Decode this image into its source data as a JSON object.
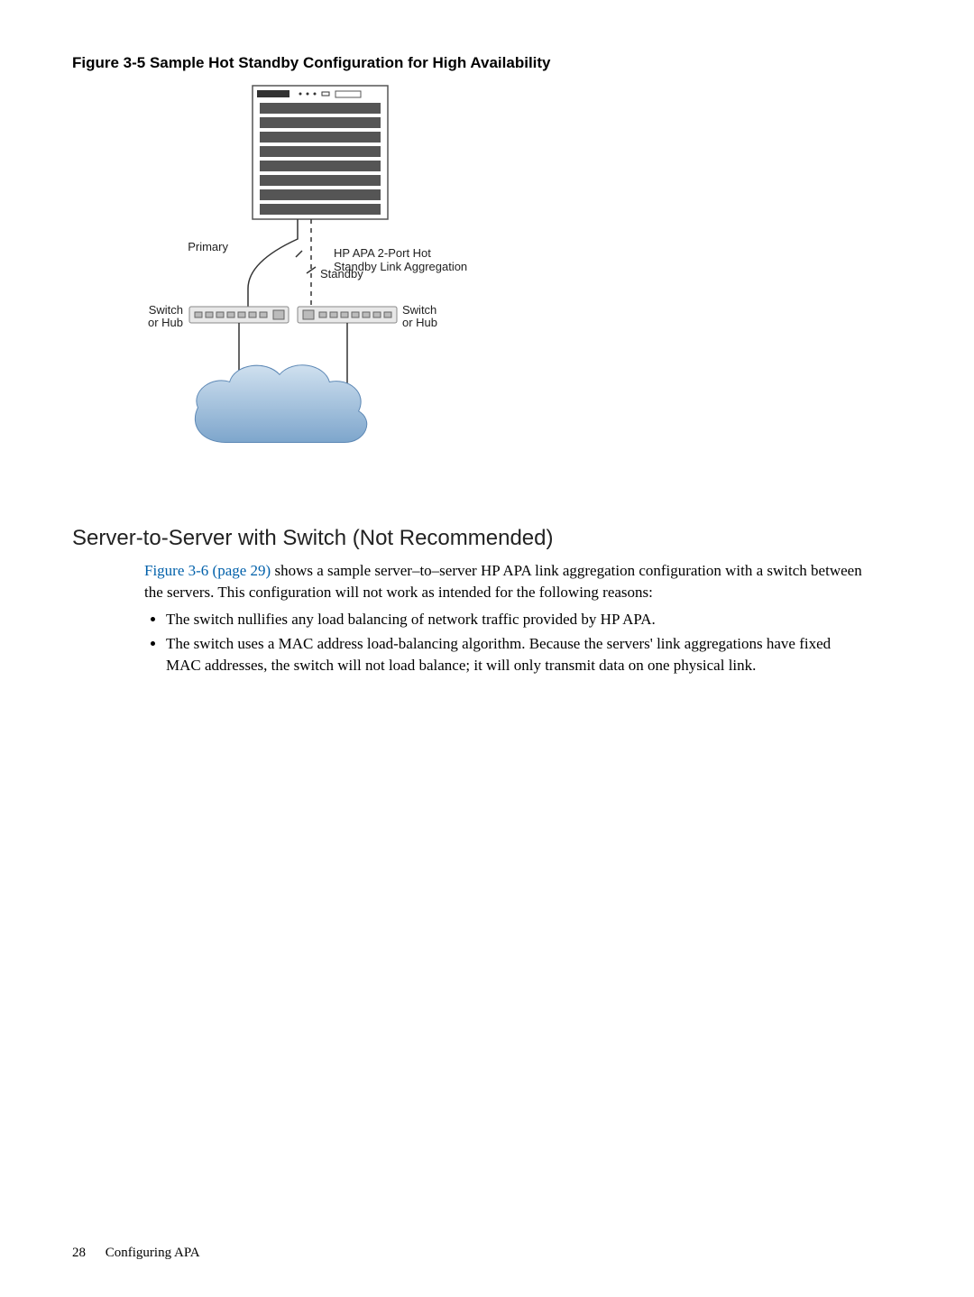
{
  "figure": {
    "caption": "Figure 3-5 Sample Hot Standby Configuration for High Availability",
    "labels": {
      "primary": "Primary",
      "standby": "Standby",
      "apa_line1": "HP APA 2-Port Hot",
      "apa_line2": "Standby Link Aggregation",
      "switch_hub_left_1": "Switch",
      "switch_hub_left_2": "or Hub",
      "switch_hub_right_1": "Switch",
      "switch_hub_right_2": "or Hub"
    }
  },
  "section": {
    "heading": "Server-to-Server with Switch (Not Recommended)",
    "para_link": "Figure 3-6 (page 29)",
    "para_rest": " shows a sample server–to–server HP APA link aggregation configuration with a switch between the servers. This configuration will not work as intended for the following reasons:",
    "bullets": [
      "The switch nullifies any load balancing of network traffic provided by HP APA.",
      "The switch uses a MAC address load-balancing algorithm. Because the servers' link aggregations have fixed MAC addresses, the switch will not load balance; it will only transmit data on one physical link."
    ]
  },
  "footer": {
    "page": "28",
    "title": "Configuring APA"
  }
}
